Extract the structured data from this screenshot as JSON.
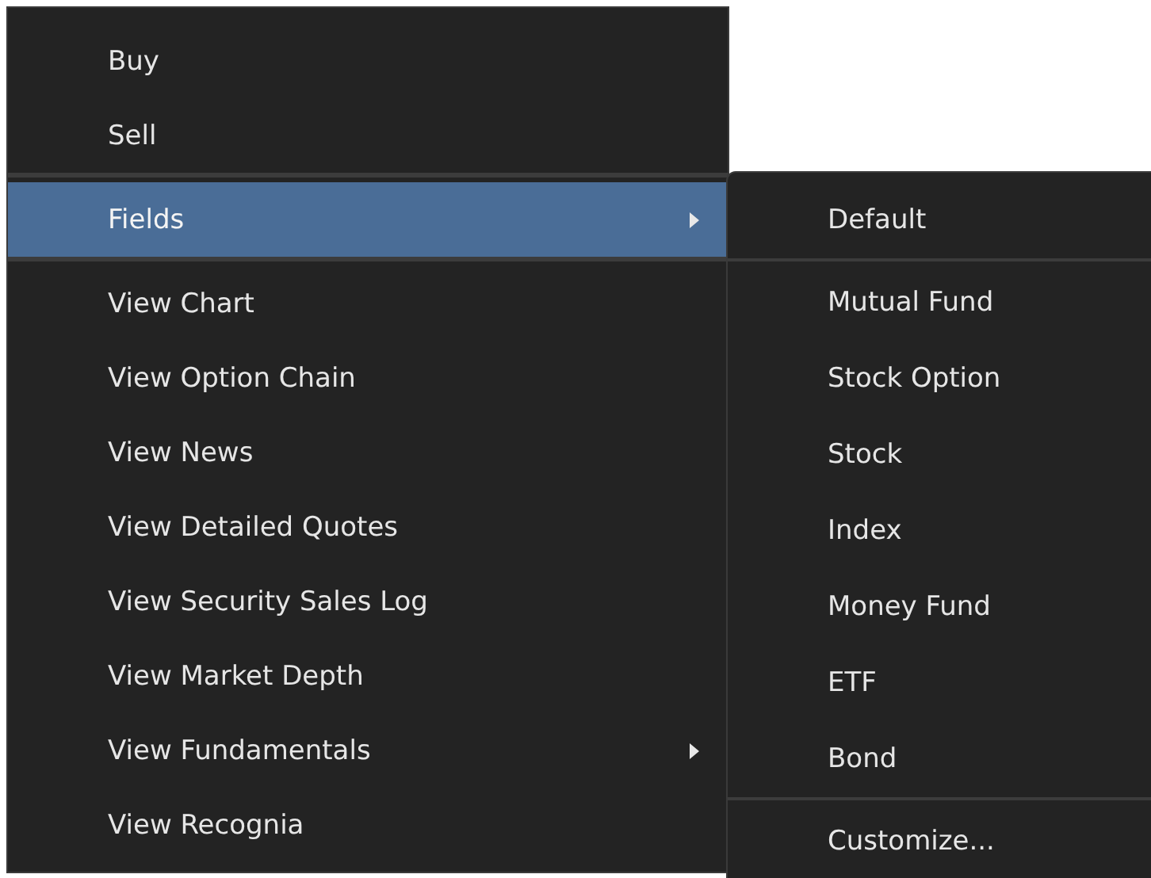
{
  "menu": {
    "items": [
      {
        "label": "Buy",
        "selected": false,
        "has_submenu": false,
        "separator_after": false
      },
      {
        "label": "Sell",
        "selected": false,
        "has_submenu": false,
        "separator_after": true
      },
      {
        "label": "Fields",
        "selected": true,
        "has_submenu": true,
        "separator_after": true
      },
      {
        "label": "View Chart",
        "selected": false,
        "has_submenu": false,
        "separator_after": false
      },
      {
        "label": "View Option Chain",
        "selected": false,
        "has_submenu": false,
        "separator_after": false
      },
      {
        "label": "View News",
        "selected": false,
        "has_submenu": false,
        "separator_after": false
      },
      {
        "label": "View Detailed Quotes",
        "selected": false,
        "has_submenu": false,
        "separator_after": false
      },
      {
        "label": "View Security Sales Log",
        "selected": false,
        "has_submenu": false,
        "separator_after": false
      },
      {
        "label": "View Market Depth",
        "selected": false,
        "has_submenu": false,
        "separator_after": false
      },
      {
        "label": "View Fundamentals",
        "selected": false,
        "has_submenu": true,
        "separator_after": false
      },
      {
        "label": "View Recognia",
        "selected": false,
        "has_submenu": false,
        "separator_after": false
      }
    ]
  },
  "submenu": {
    "items": [
      {
        "label": "Default",
        "separator_after": true
      },
      {
        "label": "Mutual Fund",
        "separator_after": false
      },
      {
        "label": "Stock Option",
        "separator_after": false
      },
      {
        "label": "Stock",
        "separator_after": false
      },
      {
        "label": "Index",
        "separator_after": false
      },
      {
        "label": "Money Fund",
        "separator_after": false
      },
      {
        "label": "ETF",
        "separator_after": false
      },
      {
        "label": "Bond",
        "separator_after": true
      },
      {
        "label": "Customize...",
        "separator_after": false
      }
    ]
  }
}
